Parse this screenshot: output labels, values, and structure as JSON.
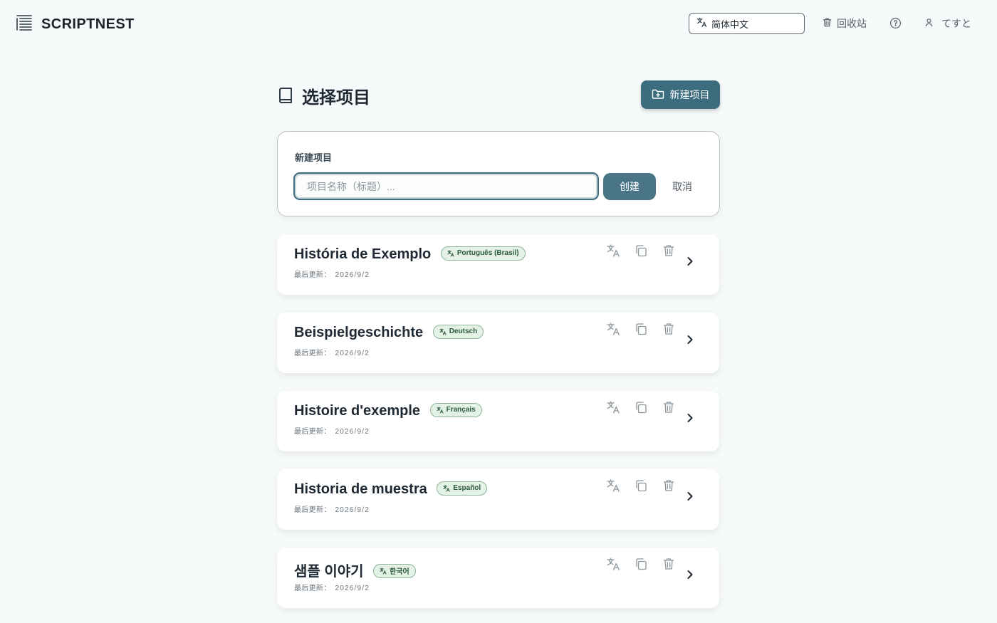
{
  "app": {
    "name": "SCRIPTNEST"
  },
  "header": {
    "language": "简体中文",
    "trash_label": "回收站",
    "user_name": "てすと"
  },
  "page": {
    "title": "选择项目",
    "new_project_label": "新建项目"
  },
  "form": {
    "label": "新建项目",
    "input_value": "",
    "input_placeholder": "项目名称（标题）...",
    "create_label": "创建",
    "cancel_label": "取消"
  },
  "projects": [
    {
      "name": "História de Exemplo",
      "language": "Português (Brasil)",
      "updated_label": "最后更新：",
      "updated_date": "2026/9/2"
    },
    {
      "name": "Beispielgeschichte",
      "language": "Deutsch",
      "updated_label": "最后更新：",
      "updated_date": "2026/9/2"
    },
    {
      "name": "Histoire d'exemple",
      "language": "Français",
      "updated_label": "最后更新：",
      "updated_date": "2026/9/2"
    },
    {
      "name": "Historia de muestra",
      "language": "Español",
      "updated_label": "最后更新：",
      "updated_date": "2026/9/2"
    },
    {
      "name": "샘플 이야기",
      "language": "한국어",
      "updated_label": "最后更新：",
      "updated_date": "2026/9/2"
    }
  ],
  "icons": {
    "logo": "list-lines-icon",
    "language": "translate-icon",
    "trash": "trash-icon",
    "help": "help-circle-icon",
    "user": "user-icon",
    "book": "book-icon",
    "folder_plus": "folder-plus-icon",
    "copy": "copy-icon",
    "chevron": "chevron-right-icon"
  },
  "colors": {
    "primary": "#3c6d7f",
    "create_button": "#4a7587",
    "badge_bg": "#e3f1e6",
    "badge_border": "#8fb49a",
    "background": "#f7fafa"
  }
}
